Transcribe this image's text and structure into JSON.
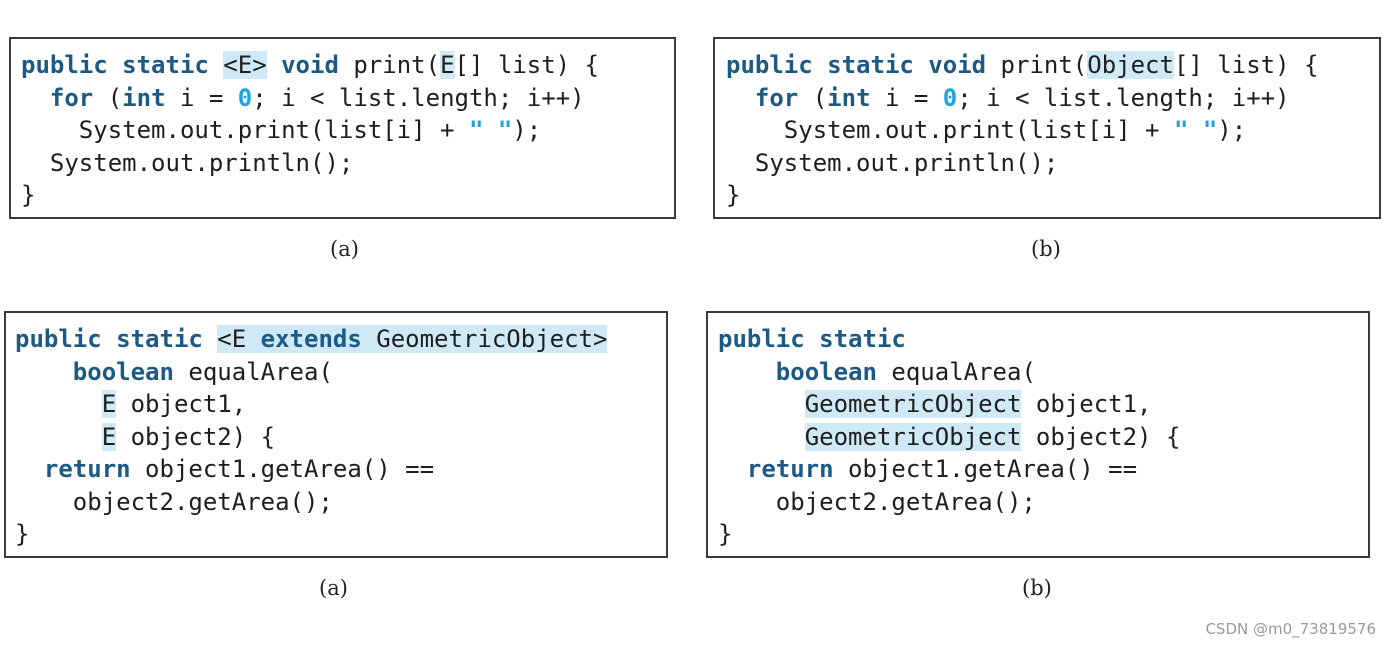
{
  "panel_top_a": {
    "lines": [
      {
        "indent": "",
        "parts": [
          {
            "t": "public static ",
            "c": "kw"
          },
          {
            "t": "<E>",
            "c": "hl"
          },
          {
            "t": " "
          },
          {
            "t": "void",
            "c": "kw"
          },
          {
            "t": " print("
          },
          {
            "t": "E",
            "c": "hl"
          },
          {
            "t": "[] list) {"
          }
        ]
      },
      {
        "indent": "  ",
        "parts": [
          {
            "t": "for",
            "c": "kw"
          },
          {
            "t": " ("
          },
          {
            "t": "int",
            "c": "kw"
          },
          {
            "t": " i = "
          },
          {
            "t": "0",
            "c": "num"
          },
          {
            "t": "; i < list.length; i++)"
          }
        ]
      },
      {
        "indent": "    ",
        "parts": [
          {
            "t": "System.out.print(list[i] + "
          },
          {
            "t": "\" \"",
            "c": "str"
          },
          {
            "t": ");"
          }
        ]
      },
      {
        "indent": "  ",
        "parts": [
          {
            "t": "System.out.println();"
          }
        ]
      },
      {
        "indent": "",
        "parts": [
          {
            "t": "}"
          }
        ]
      }
    ]
  },
  "panel_top_b": {
    "lines": [
      {
        "indent": "",
        "parts": [
          {
            "t": "public static void",
            "c": "kw"
          },
          {
            "t": " print("
          },
          {
            "t": "Object",
            "c": "hl"
          },
          {
            "t": "[] list) {"
          }
        ]
      },
      {
        "indent": "  ",
        "parts": [
          {
            "t": "for",
            "c": "kw"
          },
          {
            "t": " ("
          },
          {
            "t": "int",
            "c": "kw"
          },
          {
            "t": " i = "
          },
          {
            "t": "0",
            "c": "num"
          },
          {
            "t": "; i < list.length; i++)"
          }
        ]
      },
      {
        "indent": "    ",
        "parts": [
          {
            "t": "System.out.print(list[i] + "
          },
          {
            "t": "\" \"",
            "c": "str"
          },
          {
            "t": ");"
          }
        ]
      },
      {
        "indent": "  ",
        "parts": [
          {
            "t": "System.out.println();"
          }
        ]
      },
      {
        "indent": "",
        "parts": [
          {
            "t": "}"
          }
        ]
      }
    ]
  },
  "panel_bottom_a": {
    "lines": [
      {
        "indent": "",
        "parts": [
          {
            "t": "public static ",
            "c": "kw"
          },
          {
            "t": "<E ",
            "c": "hl"
          },
          {
            "t": "extends",
            "c": "kw hl"
          },
          {
            "t": " GeometricObject>",
            "c": "hl"
          }
        ]
      },
      {
        "indent": "    ",
        "parts": [
          {
            "t": "boolean",
            "c": "kw"
          },
          {
            "t": " equalArea("
          }
        ]
      },
      {
        "indent": "      ",
        "parts": [
          {
            "t": "E",
            "c": "hl"
          },
          {
            "t": " object1,"
          }
        ]
      },
      {
        "indent": "      ",
        "parts": [
          {
            "t": "E",
            "c": "hl"
          },
          {
            "t": " object2) {"
          }
        ]
      },
      {
        "indent": "  ",
        "parts": [
          {
            "t": "return",
            "c": "kw"
          },
          {
            "t": " object1.getArea() =="
          }
        ]
      },
      {
        "indent": "    ",
        "parts": [
          {
            "t": "object2.getArea();"
          }
        ]
      },
      {
        "indent": "",
        "parts": [
          {
            "t": "}"
          }
        ]
      }
    ]
  },
  "panel_bottom_b": {
    "lines": [
      {
        "indent": "",
        "parts": [
          {
            "t": "public static",
            "c": "kw"
          }
        ]
      },
      {
        "indent": "    ",
        "parts": [
          {
            "t": "boolean",
            "c": "kw"
          },
          {
            "t": " equalArea("
          }
        ]
      },
      {
        "indent": "      ",
        "parts": [
          {
            "t": "GeometricObject",
            "c": "hl"
          },
          {
            "t": " object1,"
          }
        ]
      },
      {
        "indent": "      ",
        "parts": [
          {
            "t": "GeometricObject",
            "c": "hl"
          },
          {
            "t": " object2) {"
          }
        ]
      },
      {
        "indent": "  ",
        "parts": [
          {
            "t": "return",
            "c": "kw"
          },
          {
            "t": " object1.getArea() =="
          }
        ]
      },
      {
        "indent": "    ",
        "parts": [
          {
            "t": "object2.getArea();"
          }
        ]
      },
      {
        "indent": "",
        "parts": [
          {
            "t": "}"
          }
        ]
      }
    ]
  },
  "captions": {
    "top_a": "(a)",
    "top_b": "(b)",
    "bottom_a": "(a)",
    "bottom_b": "(b)"
  },
  "watermark": "CSDN @m0_73819576",
  "colors": {
    "keyword": "#1d5a83",
    "literal": "#1fa3e0",
    "highlight": "#cfeaf6",
    "border": "#3a3a3a"
  }
}
